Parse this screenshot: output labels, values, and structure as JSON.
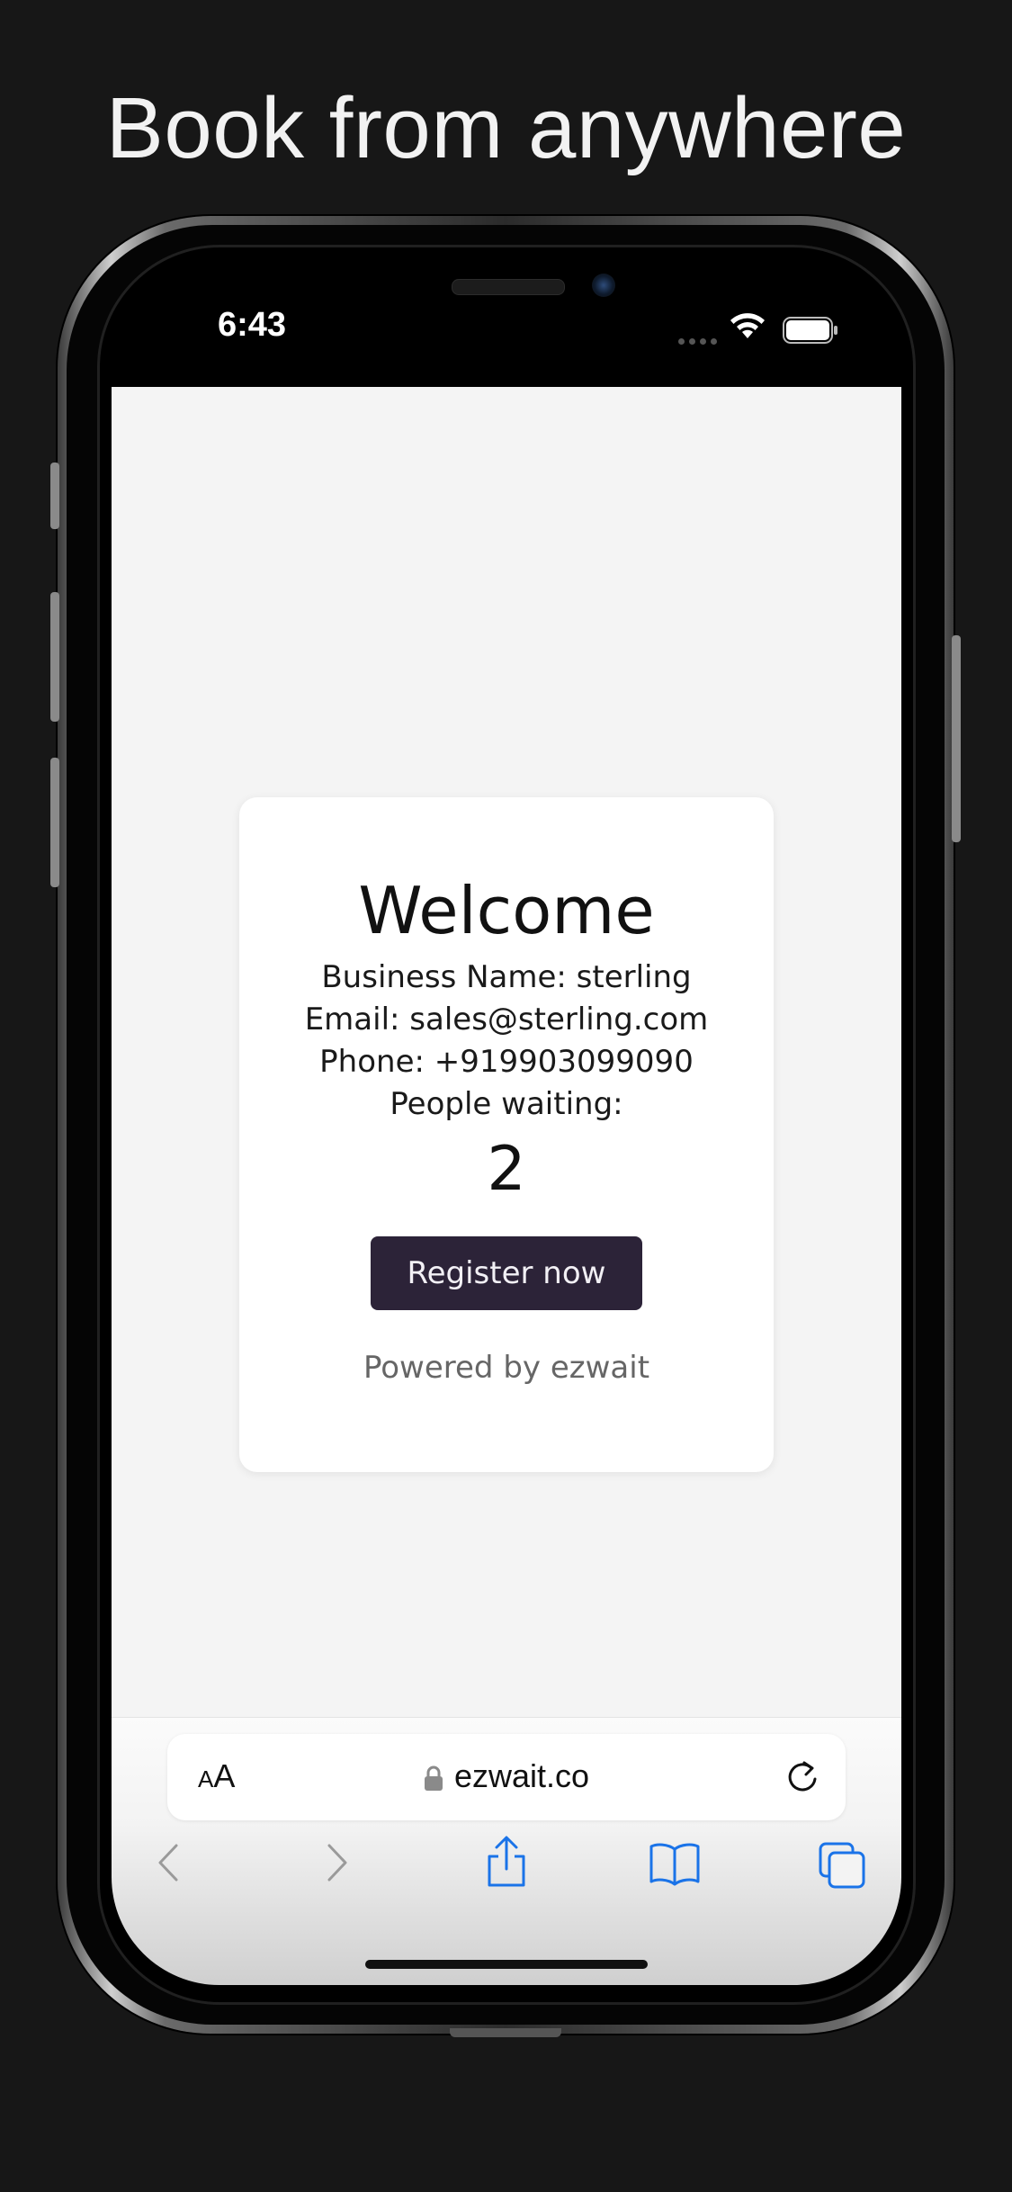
{
  "headline": "Book from anywhere",
  "status_bar": {
    "time": "6:43"
  },
  "card": {
    "title": "Welcome",
    "business_name": "Business Name: sterling",
    "email": "Email: sales@sterling.com",
    "phone": "Phone: +919903099090",
    "people_waiting_label": "People waiting:",
    "people_waiting_count": "2",
    "register_button": "Register now",
    "powered_by": "Powered by ezwait"
  },
  "browser": {
    "text_size_small": "A",
    "text_size_big": "A",
    "url": "ezwait.co",
    "icons": {
      "text_size": "text-size-icon",
      "lock": "lock-icon",
      "reload": "reload-icon",
      "back": "back-chevron-icon",
      "forward": "forward-chevron-icon",
      "share": "share-icon",
      "bookmarks": "book-icon",
      "tabs": "tabs-icon"
    }
  },
  "colors": {
    "background": "#171717",
    "button": "#2c2338",
    "accent_blue": "#1a73e8"
  }
}
